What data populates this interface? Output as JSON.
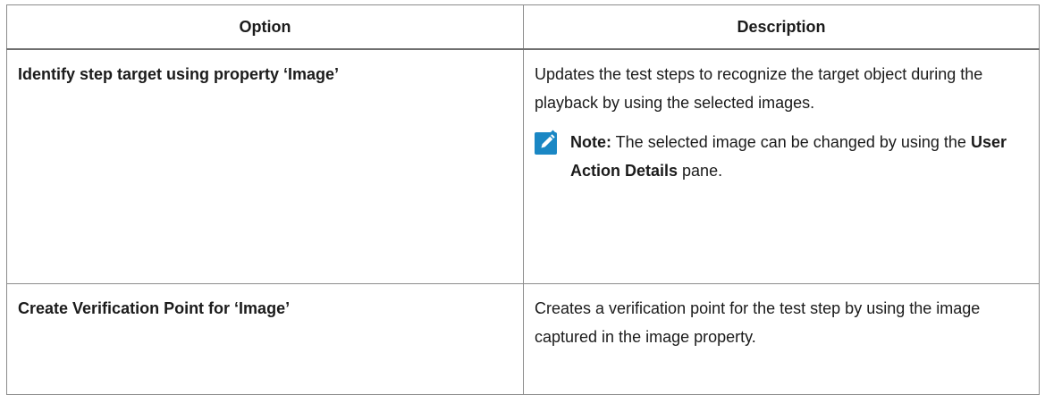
{
  "table": {
    "headers": {
      "option": "Option",
      "description": "Description"
    },
    "rows": [
      {
        "option": "Identify step target using property ‘Image’",
        "description": "Updates the test steps to recognize the target object during the playback by using the selected images.",
        "note": {
          "icon": "pencil-note-icon",
          "label": "Note:",
          "text_before": " The selected image can be changed by using the ",
          "bold_term": "User Action Details",
          "text_after": " pane."
        }
      },
      {
        "option": "Create Verification Point for ‘Image’",
        "description": "Creates a verification point for the test step by using the image captured in the image property."
      }
    ]
  },
  "colors": {
    "border": "#8c8c8c",
    "text": "#1b1b1b",
    "note_icon_bg": "#1a87c4",
    "note_icon_fg": "#ffffff"
  }
}
